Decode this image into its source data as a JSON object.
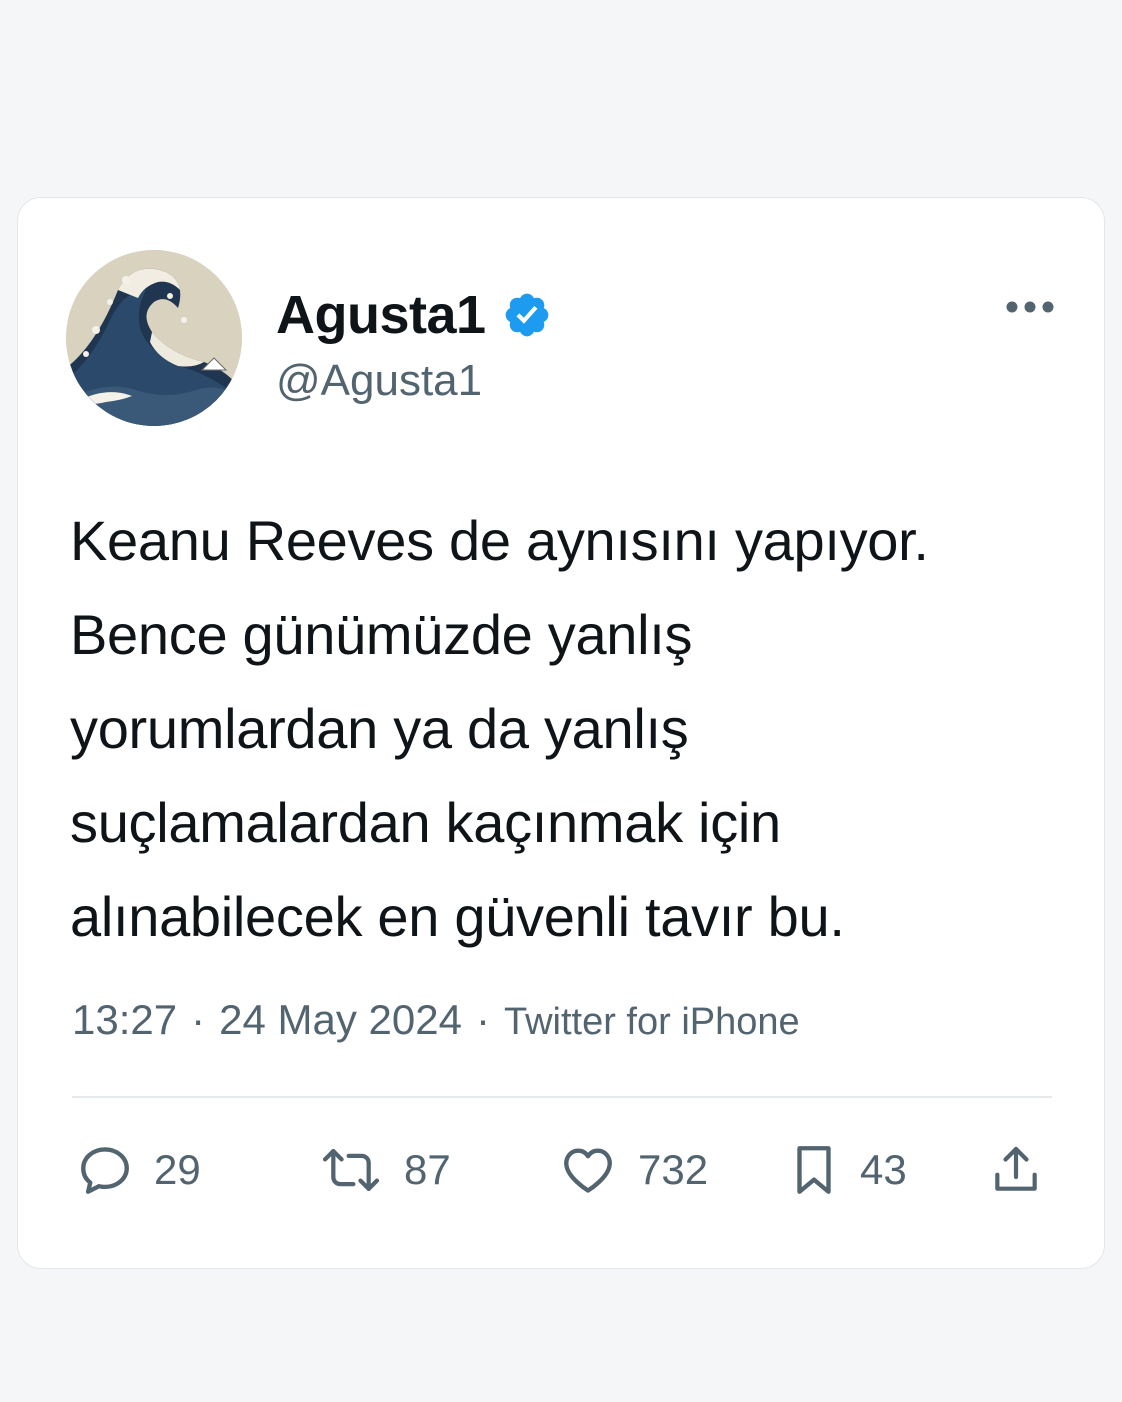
{
  "tweet": {
    "display_name": "Agusta1",
    "handle": "@Agusta1",
    "verified": true,
    "text_lines": [
      "Keanu Reeves de aynısını yapıyor.",
      "Bence günümüzde yanlış",
      "yorumlardan ya da yanlış",
      "suçlamalardan kaçınmak için",
      "alınabilecek en güvenli tavır bu."
    ],
    "time": "13:27",
    "date": "24 May 2024",
    "source": "Twitter for iPhone",
    "separator": "·"
  },
  "actions": {
    "reply_count": "29",
    "retweet_count": "87",
    "like_count": "732",
    "bookmark_count": "43"
  },
  "icons": {
    "more": "more-horizontal-icon",
    "verified": "verified-badge-icon",
    "reply": "reply-icon",
    "retweet": "retweet-icon",
    "like": "heart-icon",
    "bookmark": "bookmark-icon",
    "share": "share-icon"
  },
  "colors": {
    "text_primary": "#0f1419",
    "text_secondary": "#536471",
    "verified_blue": "#1d9bf0",
    "card_background": "#ffffff",
    "page_background": "#f5f6f8"
  }
}
